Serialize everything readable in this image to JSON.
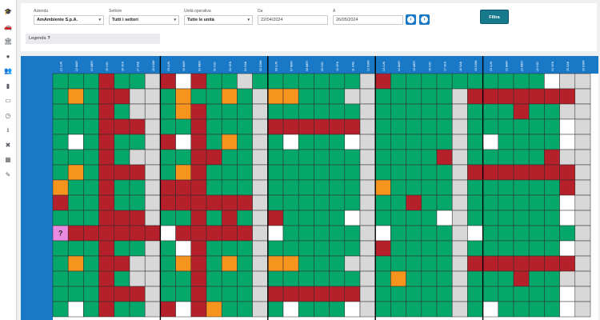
{
  "sidebar": {
    "icons": [
      "graduation-cap-icon",
      "car-icon",
      "bank-icon",
      "globe-icon",
      "users-icon",
      "id-card-icon",
      "credit-card-icon",
      "clock-icon",
      "download-icon",
      "tools-icon",
      "calendar-icon",
      "wrench-icon"
    ]
  },
  "filters": {
    "azienda": {
      "label": "Azienda",
      "value": "AmAmbiente S.p.A."
    },
    "settore": {
      "label": "Settore",
      "value": "Tutti i settori"
    },
    "unita": {
      "label": "Unità operativa",
      "value": "Tutte le unità"
    },
    "da": {
      "label": "Da",
      "value": "22/04/2024"
    },
    "a": {
      "label": "A",
      "value": "26/05/2024"
    },
    "filtra_label": "Filtra"
  },
  "legend": {
    "label": "Legenda",
    "help": "?"
  },
  "colors": {
    "blue": "#1a79c7",
    "green": "#06a76a",
    "red": "#b5202a",
    "orange": "#f7941d",
    "grey": "#d8d8d8",
    "white": "#ffffff",
    "pink": "#e88be0"
  },
  "calendar": {
    "day_headers": [
      "22 LUN",
      "23 MAR",
      "24 MER",
      "25 GIO",
      "26 VEN",
      "27 SAB",
      "28 DOM",
      "29 LUN",
      "30 MAR",
      "01 MER",
      "02 GIO",
      "03 VEN",
      "04 SAB",
      "05 DOM",
      "06 LUN",
      "07 MAR",
      "08 MER",
      "09 GIO",
      "10 VEN",
      "11 SAB",
      "12 DOM",
      "13 LUN",
      "14 MAR",
      "15 MER",
      "16 GIO",
      "17 VEN",
      "18 SAB",
      "19 DOM",
      "20 LUN",
      "21 MAR",
      "22 MER",
      "23 GIO",
      "24 VEN",
      "25 SAB",
      "26 DOM"
    ],
    "legend_codes": {
      "G": "green",
      "R": "red",
      "O": "orange",
      "L": "grey",
      "W": "white",
      "P": "pink"
    },
    "unknown_marker": "?",
    "rows": [
      "GGGRGGLRWRGGLGGGGGGGLRGGGGGGGGGGWLL",
      "GOGRRLLGOGGOGLOOGGGLLGGGGGLRRRRRRRLL",
      "GGGRGLLGORGGGLGGGGGGLGGGGGLGGGRGGLL",
      "GGGRRRLGGRGGGLRRRRRRLGGGGGLGGGGGGWL",
      "GWGRGGLRWRGOGLGWGGGWLGGGGGLGWGGGGWL",
      "GGGRGLLGGRRGGLGGGGGGLGGGGRLGGGGGRLL",
      "GOGRRRLGORGGGLGGGGGGLGGGGGLRRRRRRRL",
      "OGGRGGLRRRGGGLGGGGGGLOGGGGLGGGGGGRL",
      "RGGRGGLRRRRRRLGGGGGGLGGRGGLGGGGGGWL",
      "GGGRRRLGGRGRGLRGGGGWLGGGGWLGGGGGGWL",
      "PRRRRRRWRRRRRLWGGGGGLWGGGGLWGGGGGGL",
      "GGGRGGLGWRGGGLGGGGGGLRGGGGLGGGGGGWL",
      "GOGRRLLGORGOGLOOGGGLLGGGGGLRRRRRRRLL",
      "GGGRGLLGGRGGGLGGGGGGLGOGGGLGGGRGGLL",
      "GGGRRRLGGRGGGLRRRRRRLGGGGGLGGGGGGWL",
      "GWGRGGLRWROGGLGWGGGWLGGGGGLGWGGGGWL"
    ]
  }
}
